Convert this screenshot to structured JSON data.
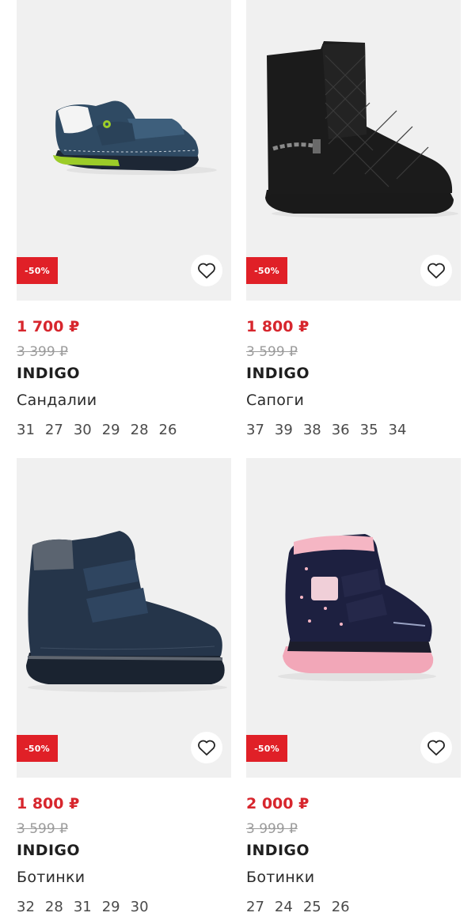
{
  "products": [
    {
      "discount": "-50%",
      "price": "1 700 ₽",
      "old_price": "3 399 ₽",
      "brand": "INDIGO",
      "name": "Сандалии",
      "sizes": [
        "31",
        "27",
        "30",
        "29",
        "28",
        "26"
      ],
      "icon": "favorite-heart-icon"
    },
    {
      "discount": "-50%",
      "price": "1 800 ₽",
      "old_price": "3 599 ₽",
      "brand": "INDIGO",
      "name": "Сапоги",
      "sizes": [
        "37",
        "39",
        "38",
        "36",
        "35",
        "34"
      ],
      "icon": "favorite-heart-icon"
    },
    {
      "discount": "-50%",
      "price": "1 800 ₽",
      "old_price": "3 599 ₽",
      "brand": "INDIGO",
      "name": "Ботинки",
      "sizes": [
        "32",
        "28",
        "31",
        "29",
        "30"
      ],
      "icon": "favorite-heart-icon"
    },
    {
      "discount": "-50%",
      "price": "2 000 ₽",
      "old_price": "3 999 ₽",
      "brand": "INDIGO",
      "name": "Ботинки",
      "sizes": [
        "27",
        "24",
        "25",
        "26"
      ],
      "icon": "favorite-heart-icon"
    }
  ],
  "colors": {
    "sale_badge": "#e02027",
    "price": "#d7262d",
    "old_price": "#9b9b9b",
    "photo_bg": "#f0f0f0"
  }
}
